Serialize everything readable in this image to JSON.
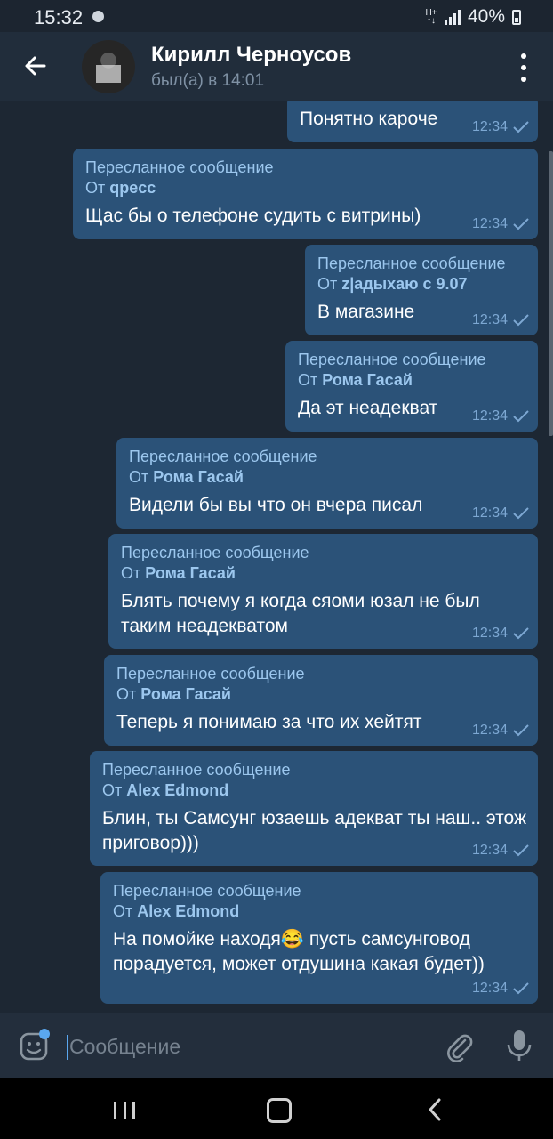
{
  "status_bar": {
    "time": "15:32",
    "battery": "40%"
  },
  "header": {
    "name": "Кирилл Черноусов",
    "status": "был(а) в 14:01"
  },
  "messages": [
    {
      "text": "Понятно кароче",
      "time": "12:34"
    },
    {
      "label": "Пересланное сообщение",
      "from_prefix": "От",
      "from": "qpecc",
      "text": "Щас бы о телефоне судить с витрины)",
      "time": "12:34"
    },
    {
      "label": "Пересланное сообщение",
      "from_prefix": "От",
      "from": "z|адыхаю с 9.07",
      "text": "В магазине",
      "time": "12:34"
    },
    {
      "label": "Пересланное сообщение",
      "from_prefix": "От",
      "from": "Рома Гасай",
      "text": "Да эт неадекват",
      "time": "12:34"
    },
    {
      "label": "Пересланное сообщение",
      "from_prefix": "От",
      "from": "Рома Гасай",
      "text": "Видели бы вы что он вчера писал",
      "time": "12:34"
    },
    {
      "label": "Пересланное сообщение",
      "from_prefix": "От",
      "from": "Рома Гасай",
      "text": "Блять почему я когда сяоми юзал не был таким неадекватом",
      "time": "12:34"
    },
    {
      "label": "Пересланное сообщение",
      "from_prefix": "От",
      "from": "Рома Гасай",
      "text": "Теперь я понимаю за что их хейтят",
      "time": "12:34"
    },
    {
      "label": "Пересланное сообщение",
      "from_prefix": "От",
      "from": "Alex Edmond",
      "text": "Блин, ты Самсунг юзаешь адекват ты наш.. этож приговор)))",
      "time": "12:34"
    },
    {
      "label": "Пересланное сообщение",
      "from_prefix": "От",
      "from": "Alex Edmond",
      "text": "На помойке находя😂 пусть самсунговод порадуется, может отдушина какая будет))",
      "time": "12:34"
    }
  ],
  "composer": {
    "placeholder": "Сообщение"
  },
  "icons": {
    "back": "arrow-left-icon",
    "menu": "more-vertical-icon",
    "sticker": "sticker-icon",
    "attach": "paperclip-icon",
    "mic": "microphone-icon",
    "check": "single-check-icon"
  },
  "colors": {
    "bubble": "#2b5278",
    "background": "#1d2733",
    "accent": "#9cc7ee"
  }
}
